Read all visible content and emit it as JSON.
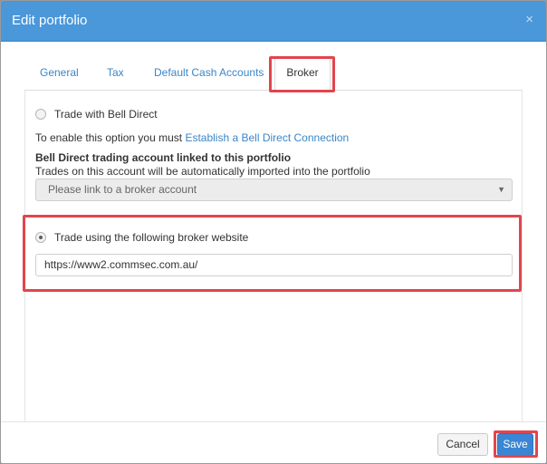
{
  "dialog": {
    "title": "Edit portfolio",
    "close_icon": "close-icon",
    "close_glyph": "×"
  },
  "tabs": [
    {
      "label": "General",
      "active": false
    },
    {
      "label": "Tax",
      "active": false
    },
    {
      "label": "Default Cash Accounts",
      "active": false
    },
    {
      "label": "Broker",
      "active": true
    }
  ],
  "broker": {
    "option1_label": "Trade with Bell Direct",
    "option1_checked": false,
    "enable_prefix": "To enable this option you must",
    "enable_link": "Establish a Bell Direct Connection",
    "account_heading": "Bell Direct trading account linked to this portfolio",
    "account_note": "Trades on this account will be automatically imported into the portfolio",
    "account_select_value": "Please link to a broker account",
    "option2_label": "Trade using the following broker website",
    "option2_checked": true,
    "website_value": "https://www2.commsec.com.au/"
  },
  "footer": {
    "cancel_label": "Cancel",
    "save_label": "Save"
  },
  "colors": {
    "header": "#4a97da",
    "highlight": "#e2454e",
    "primary_button": "#3a86d4",
    "link": "#3a86c8"
  }
}
